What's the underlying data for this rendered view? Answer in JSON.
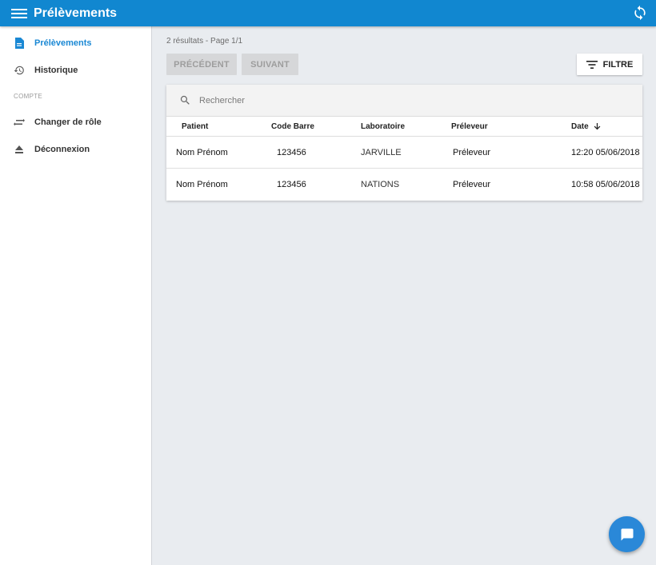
{
  "appbar": {
    "title": "Prélèvements",
    "menu_icon": "menu-icon",
    "sync_icon": "sync-icon"
  },
  "sidebar": {
    "items": [
      {
        "label": "Prélèvements",
        "icon": "document-icon",
        "active": true
      },
      {
        "label": "Historique",
        "icon": "history-icon",
        "active": false
      }
    ],
    "section_label": "COMPTE",
    "account_items": [
      {
        "label": "Changer de rôle",
        "icon": "swap-icon"
      },
      {
        "label": "Déconnexion",
        "icon": "eject-icon"
      }
    ]
  },
  "main": {
    "results_text": "2 résultats - Page 1/1",
    "prev_label": "PRÉCÉDENT",
    "next_label": "SUIVANT",
    "filter_label": "FILTRE",
    "search_placeholder": "Rechercher",
    "columns": [
      "Patient",
      "Code Barre",
      "Laboratoire",
      "Préleveur",
      "Date"
    ],
    "sort_icon": "arrow-down-icon",
    "rows": [
      {
        "patient": "Nom Prénom",
        "code": "123456",
        "lab": "JARVILLE",
        "preleveur": "Préleveur",
        "date": "12:20 05/06/2018"
      },
      {
        "patient": "Nom Prénom",
        "code": "123456",
        "lab": "NATIONS",
        "preleveur": "Préleveur",
        "date": "10:58 05/06/2018"
      }
    ]
  },
  "fab_icon": "chat-icon",
  "colors": {
    "primary": "#1187d0",
    "active_nav": "#1a88d4",
    "background": "#e9ecf0",
    "fab": "#2a88d8"
  }
}
